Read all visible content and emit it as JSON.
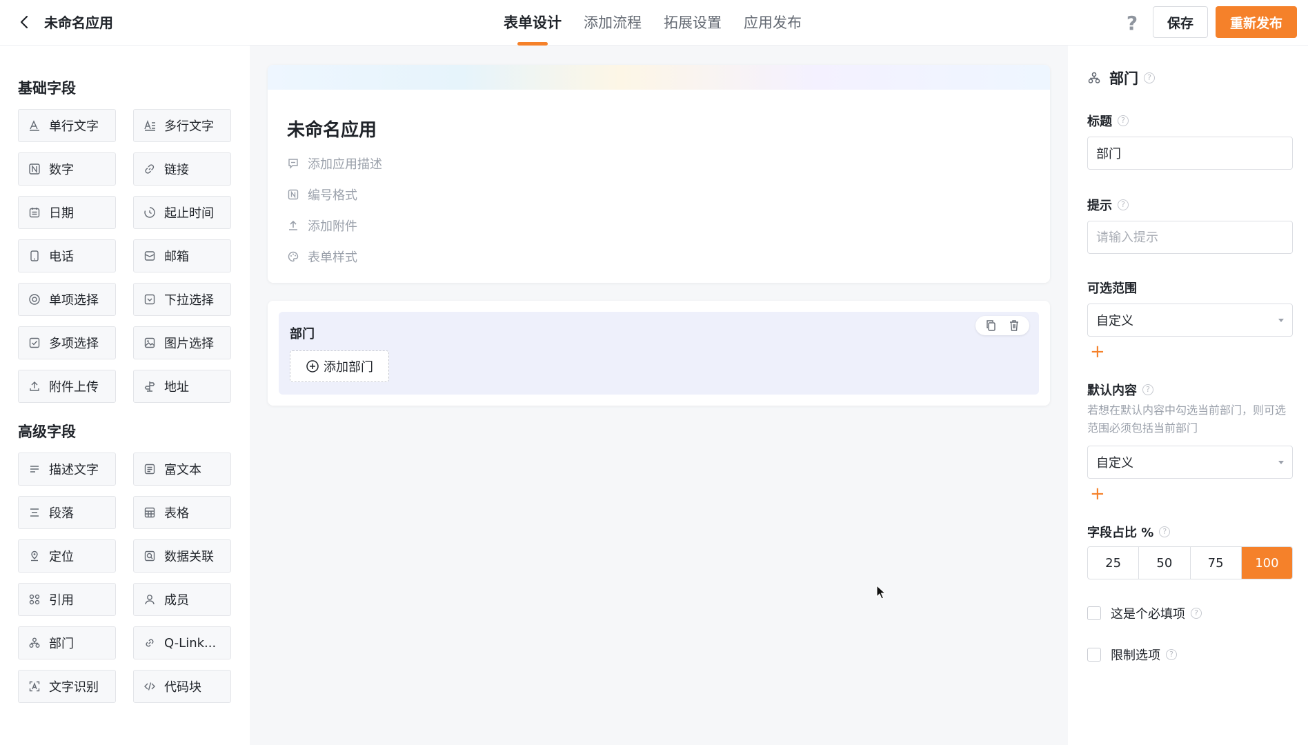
{
  "header": {
    "app_title": "未命名应用",
    "tabs": [
      {
        "label": "表单设计",
        "active": true
      },
      {
        "label": "添加流程",
        "active": false
      },
      {
        "label": "拓展设置",
        "active": false
      },
      {
        "label": "应用发布",
        "active": false
      }
    ],
    "save_label": "保存",
    "publish_label": "重新发布"
  },
  "sidebar": {
    "basic_title": "基础字段",
    "advanced_title": "高级字段",
    "basic_fields": [
      {
        "label": "单行文字",
        "icon": "single-line-text-icon"
      },
      {
        "label": "多行文字",
        "icon": "multi-line-text-icon"
      },
      {
        "label": "数字",
        "icon": "number-icon"
      },
      {
        "label": "链接",
        "icon": "link-icon"
      },
      {
        "label": "日期",
        "icon": "calendar-icon"
      },
      {
        "label": "起止时间",
        "icon": "time-range-icon"
      },
      {
        "label": "电话",
        "icon": "phone-icon"
      },
      {
        "label": "邮箱",
        "icon": "mail-icon"
      },
      {
        "label": "单项选择",
        "icon": "radio-icon"
      },
      {
        "label": "下拉选择",
        "icon": "dropdown-icon"
      },
      {
        "label": "多项选择",
        "icon": "checkbox-icon"
      },
      {
        "label": "图片选择",
        "icon": "image-icon"
      },
      {
        "label": "附件上传",
        "icon": "upload-icon"
      },
      {
        "label": "地址",
        "icon": "address-icon"
      }
    ],
    "advanced_fields": [
      {
        "label": "描述文字",
        "icon": "description-icon"
      },
      {
        "label": "富文本",
        "icon": "rich-text-icon"
      },
      {
        "label": "段落",
        "icon": "paragraph-icon"
      },
      {
        "label": "表格",
        "icon": "table-icon"
      },
      {
        "label": "定位",
        "icon": "location-icon"
      },
      {
        "label": "数据关联",
        "icon": "data-link-icon"
      },
      {
        "label": "引用",
        "icon": "reference-icon"
      },
      {
        "label": "成员",
        "icon": "member-icon"
      },
      {
        "label": "部门",
        "icon": "department-icon"
      },
      {
        "label": "Q-Link...",
        "icon": "q-link-icon"
      },
      {
        "label": "文字识别",
        "icon": "ocr-icon"
      },
      {
        "label": "代码块",
        "icon": "code-icon"
      }
    ]
  },
  "form": {
    "title": "未命名应用",
    "links": [
      {
        "label": "添加应用描述",
        "icon": "comment-icon"
      },
      {
        "label": "编号格式",
        "icon": "number-format-icon"
      },
      {
        "label": "添加附件",
        "icon": "attachment-upload-icon"
      },
      {
        "label": "表单样式",
        "icon": "palette-icon"
      }
    ],
    "selected_field": {
      "name": "部门",
      "add_label": "添加部门"
    }
  },
  "props": {
    "field_type": "部门",
    "title_label": "标题",
    "title_value": "部门",
    "hint_label": "提示",
    "hint_placeholder": "请输入提示",
    "range_label": "可选范围",
    "range_value": "自定义",
    "default_label": "默认内容",
    "default_hint": "若想在默认内容中勾选当前部门，则可选范围必须包括当前部门",
    "default_value": "自定义",
    "width_label": "字段占比 %",
    "width_options": [
      "25",
      "50",
      "75",
      "100"
    ],
    "width_selected": "100",
    "required_label": "这是个必填项",
    "limit_label": "限制选项",
    "accent_color": "#f5812a"
  }
}
